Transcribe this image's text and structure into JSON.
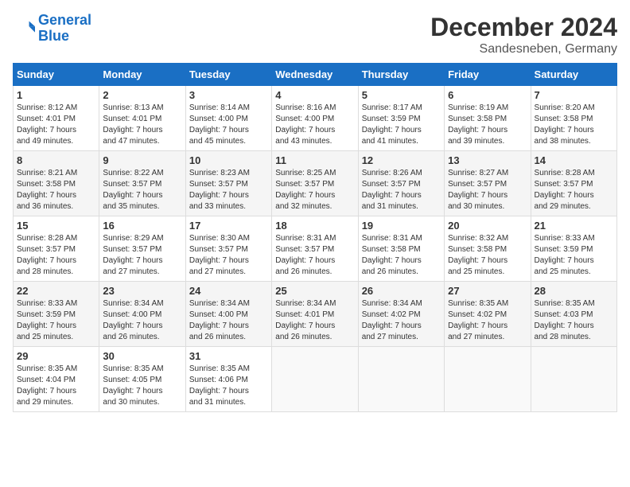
{
  "header": {
    "logo_line1": "General",
    "logo_line2": "Blue",
    "title": "December 2024",
    "subtitle": "Sandesneben, Germany"
  },
  "days_of_week": [
    "Sunday",
    "Monday",
    "Tuesday",
    "Wednesday",
    "Thursday",
    "Friday",
    "Saturday"
  ],
  "weeks": [
    [
      {
        "day": "1",
        "sunrise": "8:12 AM",
        "sunset": "4:01 PM",
        "daylight": "7 hours and 49 minutes."
      },
      {
        "day": "2",
        "sunrise": "8:13 AM",
        "sunset": "4:01 PM",
        "daylight": "7 hours and 47 minutes."
      },
      {
        "day": "3",
        "sunrise": "8:14 AM",
        "sunset": "4:00 PM",
        "daylight": "7 hours and 45 minutes."
      },
      {
        "day": "4",
        "sunrise": "8:16 AM",
        "sunset": "4:00 PM",
        "daylight": "7 hours and 43 minutes."
      },
      {
        "day": "5",
        "sunrise": "8:17 AM",
        "sunset": "3:59 PM",
        "daylight": "7 hours and 41 minutes."
      },
      {
        "day": "6",
        "sunrise": "8:19 AM",
        "sunset": "3:58 PM",
        "daylight": "7 hours and 39 minutes."
      },
      {
        "day": "7",
        "sunrise": "8:20 AM",
        "sunset": "3:58 PM",
        "daylight": "7 hours and 38 minutes."
      }
    ],
    [
      {
        "day": "8",
        "sunrise": "8:21 AM",
        "sunset": "3:58 PM",
        "daylight": "7 hours and 36 minutes."
      },
      {
        "day": "9",
        "sunrise": "8:22 AM",
        "sunset": "3:57 PM",
        "daylight": "7 hours and 35 minutes."
      },
      {
        "day": "10",
        "sunrise": "8:23 AM",
        "sunset": "3:57 PM",
        "daylight": "7 hours and 33 minutes."
      },
      {
        "day": "11",
        "sunrise": "8:25 AM",
        "sunset": "3:57 PM",
        "daylight": "7 hours and 32 minutes."
      },
      {
        "day": "12",
        "sunrise": "8:26 AM",
        "sunset": "3:57 PM",
        "daylight": "7 hours and 31 minutes."
      },
      {
        "day": "13",
        "sunrise": "8:27 AM",
        "sunset": "3:57 PM",
        "daylight": "7 hours and 30 minutes."
      },
      {
        "day": "14",
        "sunrise": "8:28 AM",
        "sunset": "3:57 PM",
        "daylight": "7 hours and 29 minutes."
      }
    ],
    [
      {
        "day": "15",
        "sunrise": "8:28 AM",
        "sunset": "3:57 PM",
        "daylight": "7 hours and 28 minutes."
      },
      {
        "day": "16",
        "sunrise": "8:29 AM",
        "sunset": "3:57 PM",
        "daylight": "7 hours and 27 minutes."
      },
      {
        "day": "17",
        "sunrise": "8:30 AM",
        "sunset": "3:57 PM",
        "daylight": "7 hours and 27 minutes."
      },
      {
        "day": "18",
        "sunrise": "8:31 AM",
        "sunset": "3:57 PM",
        "daylight": "7 hours and 26 minutes."
      },
      {
        "day": "19",
        "sunrise": "8:31 AM",
        "sunset": "3:58 PM",
        "daylight": "7 hours and 26 minutes."
      },
      {
        "day": "20",
        "sunrise": "8:32 AM",
        "sunset": "3:58 PM",
        "daylight": "7 hours and 25 minutes."
      },
      {
        "day": "21",
        "sunrise": "8:33 AM",
        "sunset": "3:59 PM",
        "daylight": "7 hours and 25 minutes."
      }
    ],
    [
      {
        "day": "22",
        "sunrise": "8:33 AM",
        "sunset": "3:59 PM",
        "daylight": "7 hours and 25 minutes."
      },
      {
        "day": "23",
        "sunrise": "8:34 AM",
        "sunset": "4:00 PM",
        "daylight": "7 hours and 26 minutes."
      },
      {
        "day": "24",
        "sunrise": "8:34 AM",
        "sunset": "4:00 PM",
        "daylight": "7 hours and 26 minutes."
      },
      {
        "day": "25",
        "sunrise": "8:34 AM",
        "sunset": "4:01 PM",
        "daylight": "7 hours and 26 minutes."
      },
      {
        "day": "26",
        "sunrise": "8:34 AM",
        "sunset": "4:02 PM",
        "daylight": "7 hours and 27 minutes."
      },
      {
        "day": "27",
        "sunrise": "8:35 AM",
        "sunset": "4:02 PM",
        "daylight": "7 hours and 27 minutes."
      },
      {
        "day": "28",
        "sunrise": "8:35 AM",
        "sunset": "4:03 PM",
        "daylight": "7 hours and 28 minutes."
      }
    ],
    [
      {
        "day": "29",
        "sunrise": "8:35 AM",
        "sunset": "4:04 PM",
        "daylight": "7 hours and 29 minutes."
      },
      {
        "day": "30",
        "sunrise": "8:35 AM",
        "sunset": "4:05 PM",
        "daylight": "7 hours and 30 minutes."
      },
      {
        "day": "31",
        "sunrise": "8:35 AM",
        "sunset": "4:06 PM",
        "daylight": "7 hours and 31 minutes."
      },
      null,
      null,
      null,
      null
    ]
  ]
}
